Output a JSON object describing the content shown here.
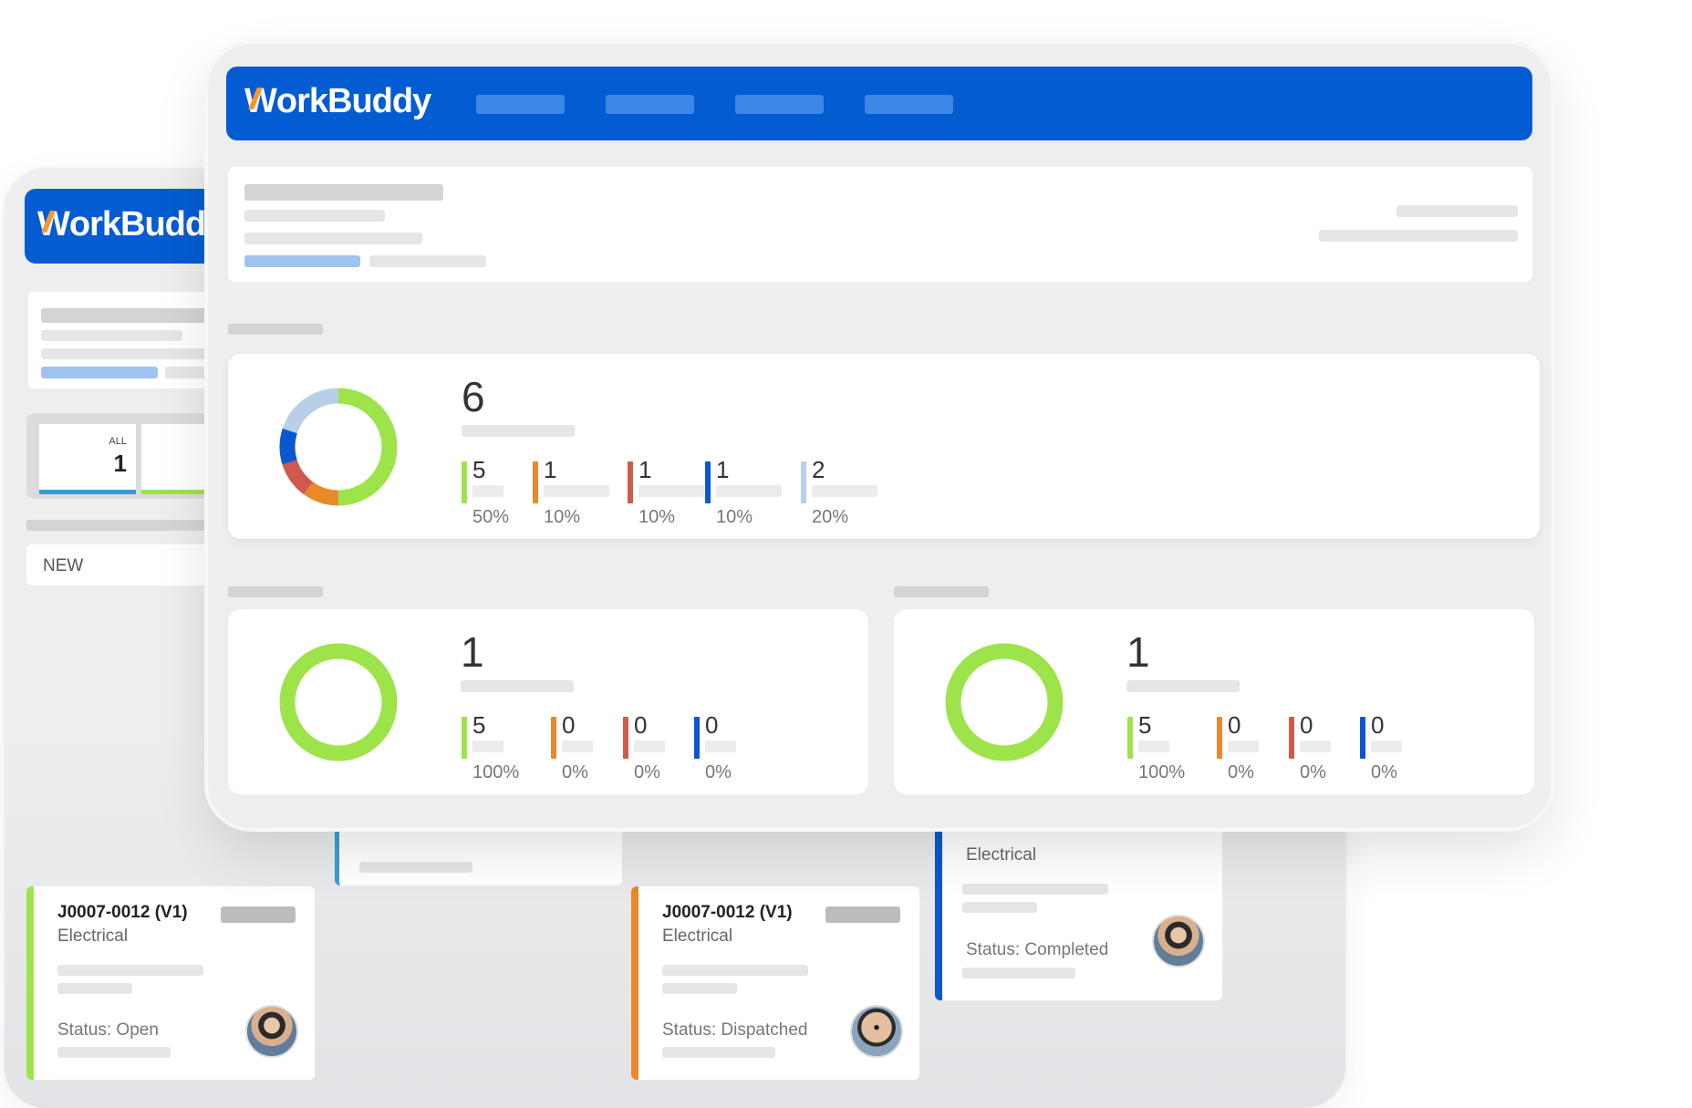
{
  "brand": {
    "name_prefix": "W",
    "name_rest": "orkBuddy"
  },
  "colors": {
    "brand_blue": "#045cd2",
    "green": "#9de34a",
    "orange": "#e8892a",
    "red": "#cf5a4b",
    "blue": "#0b57d0",
    "light_blue": "#b9cfe8"
  },
  "back_window": {
    "tab_all": {
      "label": "ALL",
      "count": "1"
    },
    "column_new": "NEW",
    "cards": [
      {
        "title": "J0007-0012 (V1)",
        "trade": "Electrical",
        "status": "Status: Open",
        "accent": "green"
      },
      {
        "title": "J0007-0012 (V1)",
        "trade": "Electrical",
        "status": "Status: Dispatched",
        "accent": "orange"
      },
      {
        "trade": "Electrical",
        "status": "Status: Completed",
        "accent": "blue"
      }
    ]
  },
  "overview": {
    "total": "6",
    "stats": [
      {
        "value": "5",
        "percent": "50%",
        "color": "green",
        "fraction": 0.5
      },
      {
        "value": "1",
        "percent": "10%",
        "color": "orange",
        "fraction": 0.1
      },
      {
        "value": "1",
        "percent": "10%",
        "color": "red",
        "fraction": 0.1
      },
      {
        "value": "1",
        "percent": "10%",
        "color": "blue",
        "fraction": 0.1
      },
      {
        "value": "2",
        "percent": "20%",
        "color": "light_blue",
        "fraction": 0.2
      }
    ]
  },
  "panel_left": {
    "total": "1",
    "stats": [
      {
        "value": "5",
        "percent": "100%",
        "color": "green",
        "fraction": 1
      },
      {
        "value": "0",
        "percent": "0%",
        "color": "orange",
        "fraction": 0
      },
      {
        "value": "0",
        "percent": "0%",
        "color": "red",
        "fraction": 0
      },
      {
        "value": "0",
        "percent": "0%",
        "color": "blue",
        "fraction": 0
      }
    ]
  },
  "panel_right": {
    "total": "1",
    "stats": [
      {
        "value": "5",
        "percent": "100%",
        "color": "green",
        "fraction": 1
      },
      {
        "value": "0",
        "percent": "0%",
        "color": "orange",
        "fraction": 0
      },
      {
        "value": "0",
        "percent": "0%",
        "color": "red",
        "fraction": 0
      },
      {
        "value": "0",
        "percent": "0%",
        "color": "blue",
        "fraction": 0
      }
    ]
  }
}
